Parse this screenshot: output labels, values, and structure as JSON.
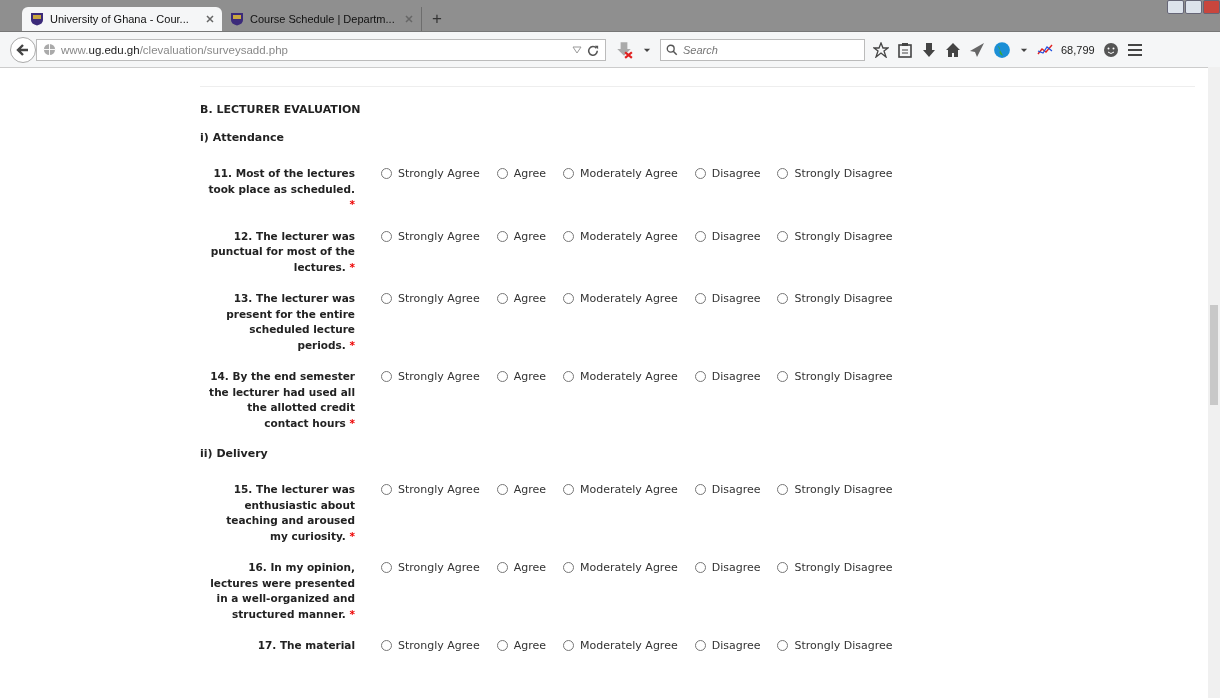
{
  "tabs": [
    {
      "title": "University of Ghana - Cour...",
      "selected": true
    },
    {
      "title": "Course Schedule | Departm...",
      "selected": false
    }
  ],
  "new_tab": "+",
  "address": {
    "prefix": "www.",
    "host": "ug.edu.gh",
    "path": "/clevaluation/surveysadd.php"
  },
  "search": {
    "placeholder": "Search"
  },
  "toolbar_count": "68,799",
  "section_title": "B. LECTURER EVALUATION",
  "groups": [
    {
      "title": "i) Attendance",
      "questions": [
        {
          "text": "11. Most of the lectures took place as scheduled.",
          "required_mark": "*",
          "options": [
            {
              "label": "Strongly Agree",
              "selected": false
            },
            {
              "label": "Agree",
              "selected": false
            },
            {
              "label": "Moderately Agree",
              "selected": false
            },
            {
              "label": "Disagree",
              "selected": false
            },
            {
              "label": "Strongly Disagree",
              "selected": false
            }
          ]
        },
        {
          "text": "12. The lecturer was punctual for most of the lectures.",
          "required_mark": "*",
          "options": [
            {
              "label": "Strongly Agree",
              "selected": false
            },
            {
              "label": "Agree",
              "selected": false
            },
            {
              "label": "Moderately Agree",
              "selected": false
            },
            {
              "label": "Disagree",
              "selected": false
            },
            {
              "label": "Strongly Disagree",
              "selected": false
            }
          ]
        },
        {
          "text": "13. The lecturer was present for the entire scheduled lecture periods.",
          "required_mark": "*",
          "options": [
            {
              "label": "Strongly Agree",
              "selected": false
            },
            {
              "label": "Agree",
              "selected": false
            },
            {
              "label": "Moderately Agree",
              "selected": false
            },
            {
              "label": "Disagree",
              "selected": false
            },
            {
              "label": "Strongly Disagree",
              "selected": false
            }
          ]
        },
        {
          "text": "14. By the end semester the lecturer had used all the allotted credit contact hours",
          "required_mark": "*",
          "options": [
            {
              "label": "Strongly Agree",
              "selected": false
            },
            {
              "label": "Agree",
              "selected": false
            },
            {
              "label": "Moderately Agree",
              "selected": false
            },
            {
              "label": "Disagree",
              "selected": false
            },
            {
              "label": "Strongly Disagree",
              "selected": false
            }
          ]
        }
      ]
    },
    {
      "title": "ii) Delivery",
      "questions": [
        {
          "text": "15. The lecturer was enthusiastic about teaching and aroused my curiosity.",
          "required_mark": "*",
          "options": [
            {
              "label": "Strongly Agree",
              "selected": false
            },
            {
              "label": "Agree",
              "selected": false
            },
            {
              "label": "Moderately Agree",
              "selected": false
            },
            {
              "label": "Disagree",
              "selected": false
            },
            {
              "label": "Strongly Disagree",
              "selected": false
            }
          ]
        },
        {
          "text": "16. In my opinion, lectures were presented in a well-organized and structured manner.",
          "required_mark": "*",
          "options": [
            {
              "label": "Strongly Agree",
              "selected": false
            },
            {
              "label": "Agree",
              "selected": false
            },
            {
              "label": "Moderately Agree",
              "selected": false
            },
            {
              "label": "Disagree",
              "selected": false
            },
            {
              "label": "Strongly Disagree",
              "selected": false
            }
          ]
        },
        {
          "text": "17. The material",
          "options": [
            {
              "label": "Strongly Agree",
              "selected": false
            },
            {
              "label": "Agree",
              "selected": false
            },
            {
              "label": "Moderately Agree",
              "selected": false
            },
            {
              "label": "Disagree",
              "selected": false
            },
            {
              "label": "Strongly Disagree",
              "selected": false
            }
          ]
        }
      ]
    }
  ]
}
